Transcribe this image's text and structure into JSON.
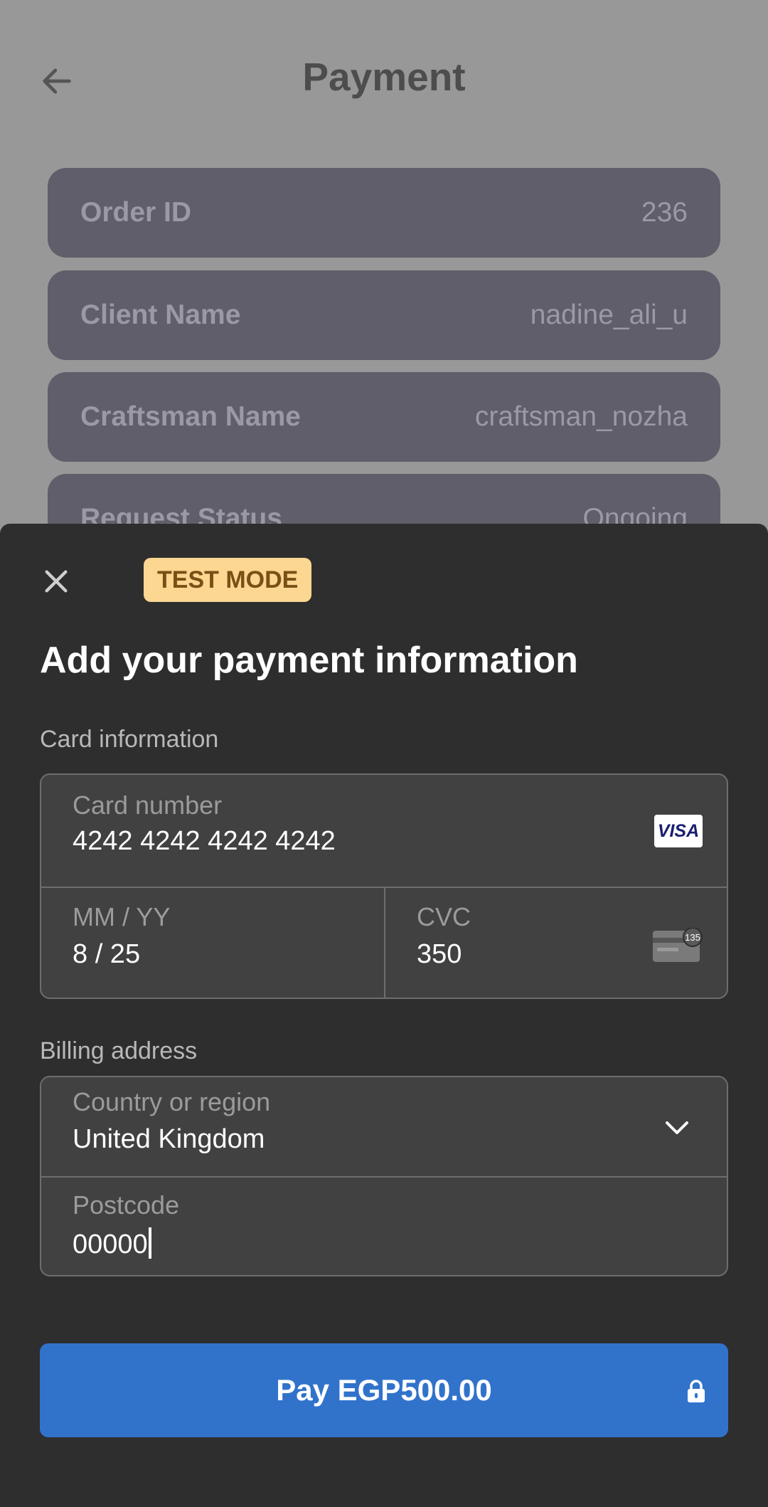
{
  "header": {
    "title": "Payment",
    "back_icon": "arrow-left-icon"
  },
  "order_info": [
    {
      "label": "Order ID",
      "value": "236"
    },
    {
      "label": "Client Name",
      "value": "nadine_ali_u"
    },
    {
      "label": "Craftsman Name",
      "value": "craftsman_nozha"
    },
    {
      "label": "Request Status",
      "value": "Ongoing"
    }
  ],
  "sheet": {
    "close_icon": "close-icon",
    "badge": "TEST MODE",
    "heading": "Add your payment information",
    "card_section_label": "Card information",
    "card_number": {
      "label": "Card number",
      "value": "4242 4242 4242 4242",
      "brand": "VISA"
    },
    "expiry": {
      "label": "MM / YY",
      "value": "8 / 25"
    },
    "cvc": {
      "label": "CVC",
      "value": "350",
      "icon_text": "135"
    },
    "billing_section_label": "Billing address",
    "country": {
      "label": "Country or region",
      "value": "United Kingdom"
    },
    "postcode": {
      "label": "Postcode",
      "value": "00000"
    },
    "pay_button": "Pay EGP500.00"
  },
  "colors": {
    "overlay_bg": "#989898",
    "sheet_bg": "#2e2e2e",
    "field_bg": "#414141",
    "accent": "#3173cb",
    "badge_bg": "#fbd792"
  }
}
